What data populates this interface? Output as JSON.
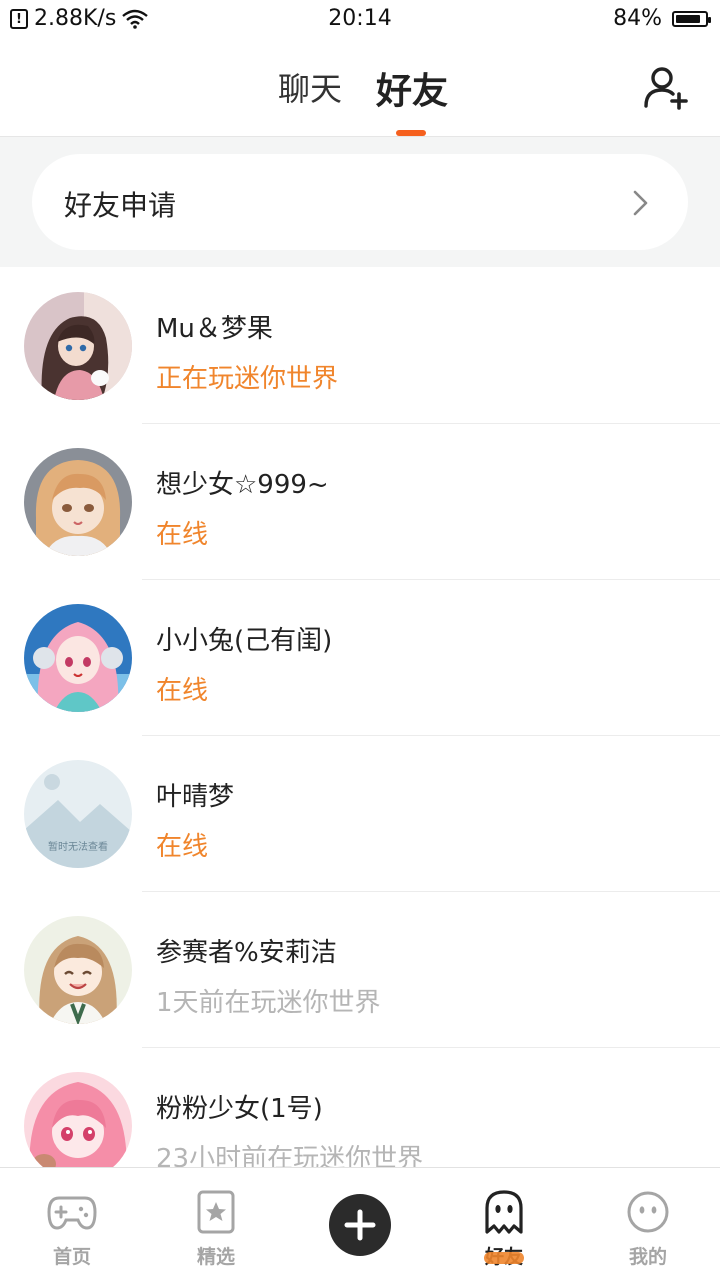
{
  "status_bar": {
    "speed": "2.88K/s",
    "time": "20:14",
    "battery_text": "84%",
    "battery_level": 0.84
  },
  "header": {
    "tabs": [
      {
        "label": "聊天",
        "active": false
      },
      {
        "label": "好友",
        "active": true
      }
    ],
    "add_friend_icon": "add-user-icon"
  },
  "friend_request": {
    "label": "好友申请",
    "icon": "chevron-right-icon"
  },
  "friends": [
    {
      "name": "Mu＆梦果",
      "status": "正在玩迷你世界",
      "online": true,
      "avatar": "anime-girl-brown-hair"
    },
    {
      "name": "想少女☆999~",
      "status": "在线",
      "online": true,
      "avatar": "anime-girl-blonde"
    },
    {
      "name": "小小兔(己有闺)",
      "status": "在线",
      "online": true,
      "avatar": "anime-girl-pink-hair"
    },
    {
      "name": "叶晴梦",
      "status": "在线",
      "online": true,
      "avatar": "placeholder-image",
      "avatar_caption": "暂时无法查看"
    },
    {
      "name": "参赛者%安莉洁",
      "status": "1天前在玩迷你世界",
      "online": false,
      "avatar": "anime-girl-smiling"
    },
    {
      "name": "粉粉少女(1号)",
      "status": "23小时前在玩迷你世界",
      "online": false,
      "avatar": "anime-girl-pink"
    }
  ],
  "bottom_nav": {
    "items": [
      {
        "label": "首页",
        "icon": "gamepad-icon",
        "active": false
      },
      {
        "label": "精选",
        "icon": "star-bookmark-icon",
        "active": false
      },
      {
        "label": "",
        "icon": "plus-icon",
        "active": false
      },
      {
        "label": "好友",
        "icon": "ghost-icon",
        "active": true
      },
      {
        "label": "我的",
        "icon": "face-icon",
        "active": false
      }
    ]
  },
  "colors": {
    "accent": "#f0852c",
    "tab_indicator": "#f5601e",
    "offline": "#b5b5b5"
  }
}
